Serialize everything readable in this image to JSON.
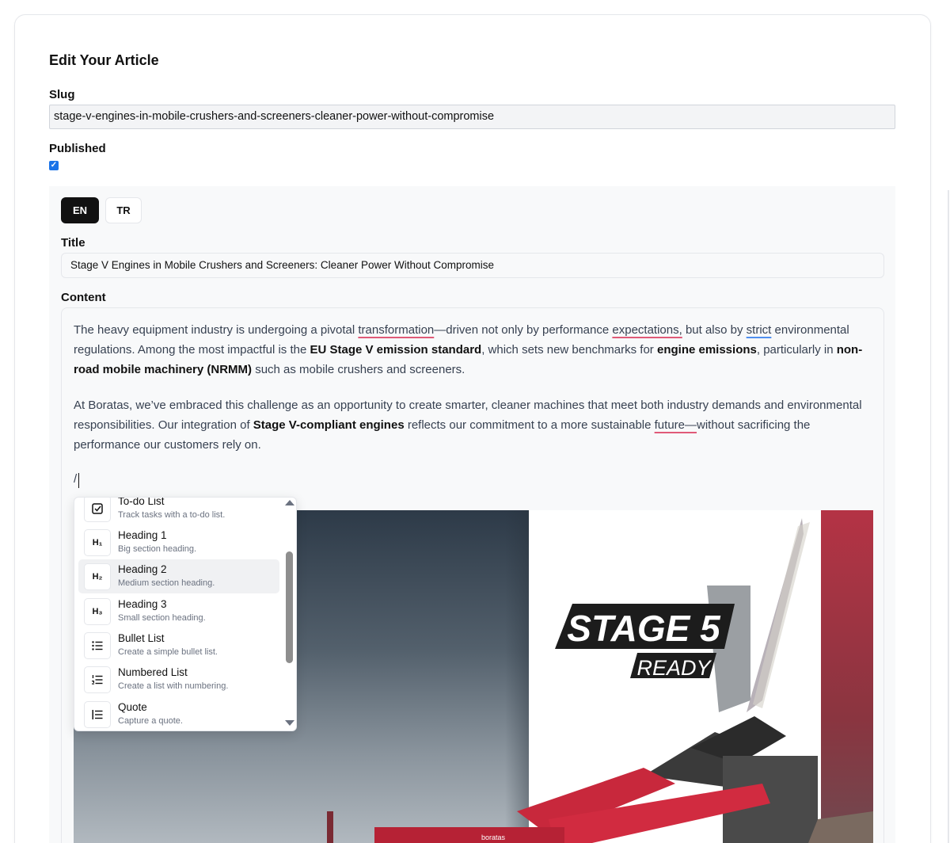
{
  "page": {
    "title": "Edit Your Article"
  },
  "slug": {
    "label": "Slug",
    "value": "stage-v-engines-in-mobile-crushers-and-screeners-cleaner-power-without-compromise"
  },
  "published": {
    "label": "Published",
    "checked": true
  },
  "languages": {
    "tabs": [
      {
        "label": "EN",
        "active": true
      },
      {
        "label": "TR",
        "active": false
      }
    ]
  },
  "title_field": {
    "label": "Title",
    "value": "Stage V Engines in Mobile Crushers and Screeners: Cleaner Power Without Compromise"
  },
  "content": {
    "label": "Content",
    "p1": {
      "t1": "The heavy equipment industry is undergoing a pivotal ",
      "w1": "transformation",
      "t2": "—driven not only by performance ",
      "w2": "expectations,",
      "t3": " but also by ",
      "w3": "strict",
      "t4": " environmental regulations. Among the most impactful is the ",
      "b1": "EU Stage V emission standard",
      "t5": ", which sets new benchmarks for ",
      "b2": "engine emissions",
      "t6": ", particularly in ",
      "b3": "non-road mobile machinery (NRMM)",
      "t7": " such as mobile crushers and screeners."
    },
    "p2": {
      "t1": "At Boratas, we’ve embraced this challenge as an opportunity to create smarter, cleaner machines that meet both industry demands and environmental responsibilities. Our integration of ",
      "b1": "Stage V-compliant engines",
      "t2": " reflects our commitment to a more sustainable ",
      "w1": "future—",
      "t3": "without sacrificing the performance our customers rely on."
    },
    "slash_input": "/",
    "image": {
      "logo_line1": "STAGE 5",
      "logo_line2": "READY",
      "machine_brand": "boratas"
    }
  },
  "slash_menu": {
    "items": [
      {
        "name": "To-do List",
        "desc": "Track tasks with a to-do list.",
        "icon": "checkbox-icon",
        "active": false
      },
      {
        "name": "Heading 1",
        "desc": "Big section heading.",
        "icon": "heading1-icon",
        "glyph": "H₁",
        "active": false
      },
      {
        "name": "Heading 2",
        "desc": "Medium section heading.",
        "icon": "heading2-icon",
        "glyph": "H₂",
        "active": true
      },
      {
        "name": "Heading 3",
        "desc": "Small section heading.",
        "icon": "heading3-icon",
        "glyph": "H₃",
        "active": false
      },
      {
        "name": "Bullet List",
        "desc": "Create a simple bullet list.",
        "icon": "bullet-list-icon",
        "active": false
      },
      {
        "name": "Numbered List",
        "desc": "Create a list with numbering.",
        "icon": "numbered-list-icon",
        "active": false
      },
      {
        "name": "Quote",
        "desc": "Capture a quote.",
        "icon": "quote-icon",
        "active": false
      }
    ]
  },
  "colors": {
    "accent": "#1a73e8",
    "active_tab": "#111111",
    "spell_error": "#e05a78",
    "grammar": "#4f8ff0"
  }
}
